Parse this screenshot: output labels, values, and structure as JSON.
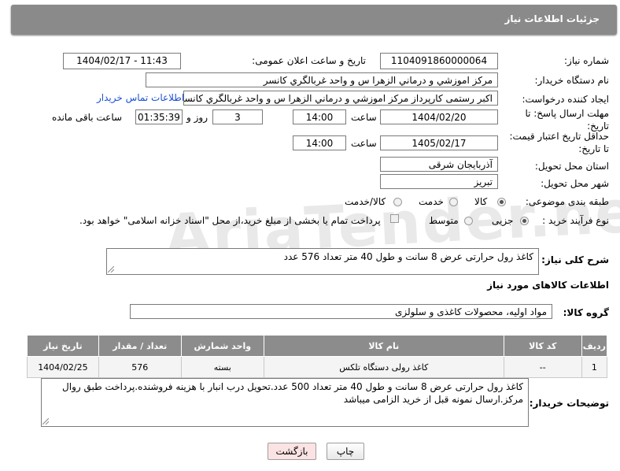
{
  "header": {
    "title": "جزئیات اطلاعات نیاز"
  },
  "watermark": "AriaTender.neT",
  "fields": {
    "need_number_label": "شماره نیاز:",
    "need_number": "1104091860000064",
    "announce_label": "تاریخ و ساعت اعلان عمومی:",
    "announce_value": "1404/02/17 - 11:43",
    "buyer_label": "نام دستگاه خریدار:",
    "buyer_value": "مرکز اموزشي و درماني الزهرا س  و واحد غربالگري کانسر",
    "creator_label": "ایجاد کننده درخواست:",
    "creator_value": "اکبر رستمی کارپرداز مرکز اموزشي و درماني الزهرا س  و واحد غربالگري کانسر",
    "contact_link": "اطلاعات تماس خریدار",
    "deadline_label_1": "مهلت ارسال پاسخ: تا",
    "deadline_label_2": "تاریخ:",
    "deadline_date": "1404/02/20",
    "time_label": "ساعت",
    "deadline_time": "14:00",
    "days_value": "3",
    "days_label": "روز و",
    "remaining_time": "01:35:39",
    "remaining_label": "ساعت باقی مانده",
    "price_label_1": "حداقل تاریخ اعتبار قیمت:",
    "price_label_2": "تا تاریخ:",
    "price_date": "1405/02/17",
    "price_time": "14:00",
    "province_label": "استان محل تحویل:",
    "province_value": "آذربایجان شرقی",
    "city_label": "شهر محل تحویل:",
    "city_value": "تبریز",
    "category_label": "طبقه بندی موضوعی:",
    "category_options": [
      "کالا",
      "خدمت",
      "کالا/خدمت"
    ],
    "process_label": "نوع فرآیند خرید :",
    "process_options": [
      "جزیی",
      "متوسط"
    ],
    "payment_note": "پرداخت تمام یا بخشی از مبلغ خرید،از محل \"اسناد خزانه اسلامی\" خواهد بود.",
    "desc_label": "شرح کلی نیاز:",
    "desc_value": "کاغذ رول حرارتی عرض 8 سانت و طول 40 متر تعداد 576 عدد",
    "goods_info_title": "اطلاعات کالاهای مورد نیاز",
    "goods_group_label": "گروه کالا:",
    "goods_group_value": "مواد اولیه، محصولات کاغذی و سلولزی"
  },
  "table": {
    "headers": [
      "ردیف",
      "کد کالا",
      "نام کالا",
      "واحد شمارش",
      "تعداد / مقدار",
      "تاریخ نیاز"
    ],
    "rows": [
      [
        "1",
        "--",
        "کاغذ رولی دستگاه تلکس",
        "بسته",
        "576",
        "1404/02/25"
      ]
    ]
  },
  "buyer_notes_label": "توضیحات خریدار:",
  "buyer_notes": "کاغذ رول حرارتی عرض 8 سانت و طول 40 متر تعداد 500 عدد.تحویل درب انبار با هزینه فروشنده.پرداخت طبق روال مرکز.ارسال نمونه قبل از خرید الزامی میباشد",
  "buttons": {
    "print": "چاپ",
    "back": "بازگشت"
  },
  "colors": {
    "header_bg": "#8a8a8a",
    "link": "#1a4fd6",
    "back_button_bg": "#fbe3e3"
  }
}
